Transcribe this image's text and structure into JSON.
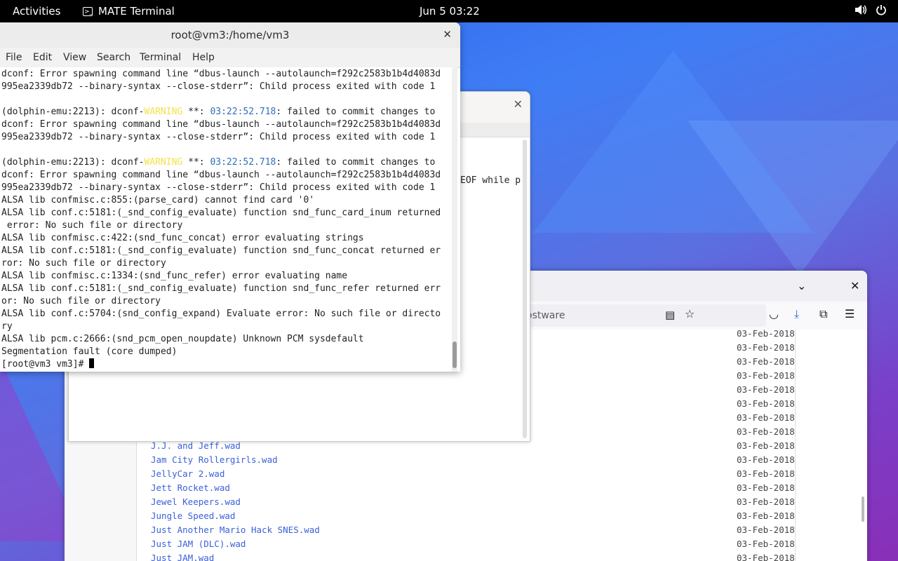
{
  "topbar": {
    "activities": "Activities",
    "app_name": "MATE Terminal",
    "clock": "Jun 5  03:22"
  },
  "terminal": {
    "title": "root@vm3:/home/vm3",
    "menu": [
      "File",
      "Edit",
      "View",
      "Search",
      "Terminal",
      "Help"
    ],
    "lines": [
      {
        "t": "dconf: Error spawning command line “dbus-launch --autolaunch=f292c2583b1b4d4083d"
      },
      {
        "t": "995ea2339db72 --binary-syntax --close-stderr”: Child process exited with code 1"
      },
      {
        "t": ""
      },
      {
        "pre": "(dolphin-emu:2213): dconf-",
        "warn": "WARNING",
        "mid": " **: ",
        "ts": "03:22:52.718",
        "post": ": failed to commit changes to"
      },
      {
        "t": "dconf: Error spawning command line “dbus-launch --autolaunch=f292c2583b1b4d4083d"
      },
      {
        "t": "995ea2339db72 --binary-syntax --close-stderr”: Child process exited with code 1"
      },
      {
        "t": ""
      },
      {
        "pre": "(dolphin-emu:2213): dconf-",
        "warn": "WARNING",
        "mid": " **: ",
        "ts": "03:22:52.718",
        "post": ": failed to commit changes to"
      },
      {
        "t": "dconf: Error spawning command line “dbus-launch --autolaunch=f292c2583b1b4d4083d"
      },
      {
        "t": "995ea2339db72 --binary-syntax --close-stderr”: Child process exited with code 1"
      },
      {
        "t": "ALSA lib confmisc.c:855:(parse_card) cannot find card '0'"
      },
      {
        "t": "ALSA lib conf.c:5181:(_snd_config_evaluate) function snd_func_card_inum returned"
      },
      {
        "t": " error: No such file or directory"
      },
      {
        "t": "ALSA lib confmisc.c:422:(snd_func_concat) error evaluating strings"
      },
      {
        "t": "ALSA lib conf.c:5181:(_snd_config_evaluate) function snd_func_concat returned er"
      },
      {
        "t": "ror: No such file or directory"
      },
      {
        "t": "ALSA lib confmisc.c:1334:(snd_func_refer) error evaluating name"
      },
      {
        "t": "ALSA lib conf.c:5181:(_snd_config_evaluate) function snd_func_refer returned err"
      },
      {
        "t": "or: No such file or directory"
      },
      {
        "t": "ALSA lib conf.c:5704:(snd_config_expand) Evaluate error: No such file or directo"
      },
      {
        "t": "ry"
      },
      {
        "t": "ALSA lib pcm.c:2666:(snd_pcm_open_noupdate) Unknown PCM sysdefault"
      },
      {
        "t": "Segmentation fault (core dumped)"
      }
    ],
    "prompt": "[root@vm3 vm3]# "
  },
  "dialog": {
    "peek_text": "EOF while p"
  },
  "browser": {
    "url_text": "ostware",
    "files": [
      "J.J. and Jeff.wad",
      "Jam City Rollergirls.wad",
      "JellyCar 2.wad",
      "Jett Rocket.wad",
      "Jewel Keepers.wad",
      "Jungle Speed.wad",
      "Just Another Mario Hack SNES.wad",
      "Just JAM (DLC).wad",
      "Just JAM.wad"
    ],
    "dates": [
      "03-Feb-2018",
      "03-Feb-2018",
      "03-Feb-2018",
      "03-Feb-2018",
      "03-Feb-2018",
      "03-Feb-2018",
      "03-Feb-2018",
      "03-Feb-2018",
      "03-Feb-2018",
      "03-Feb-2018",
      "03-Feb-2018",
      "03-Feb-2018",
      "03-Feb-2018",
      "03-Feb-2018",
      "03-Feb-2018",
      "03-Feb-2018",
      "03-Feb-2018"
    ]
  },
  "colors": {
    "warning": "#f3e14b",
    "timestamp": "#2f6fb5",
    "link": "#3b60d8"
  }
}
